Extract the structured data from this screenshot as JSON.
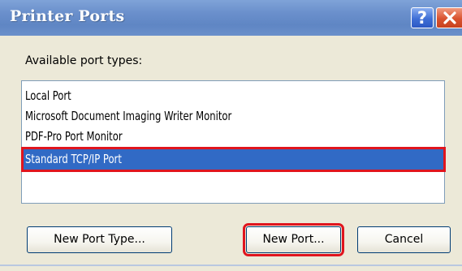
{
  "dialog": {
    "title": "Printer Ports",
    "help_button": "?",
    "close_icon": "close-icon"
  },
  "available_label": "Available port types:",
  "port_types": [
    {
      "label": "Local Port",
      "selected": false
    },
    {
      "label": "Microsoft Document Imaging Writer Monitor",
      "selected": false
    },
    {
      "label": "PDF-Pro Port Monitor",
      "selected": false
    },
    {
      "label": "Standard TCP/IP Port",
      "selected": true
    }
  ],
  "buttons": {
    "new_port_type": "New Port Type...",
    "new_port": "New Port...",
    "cancel": "Cancel"
  },
  "colors": {
    "titlebar": "#6b90cc",
    "selection": "#316ac5",
    "highlight_box": "#e0151e",
    "dialog_bg": "#ece9d8"
  }
}
